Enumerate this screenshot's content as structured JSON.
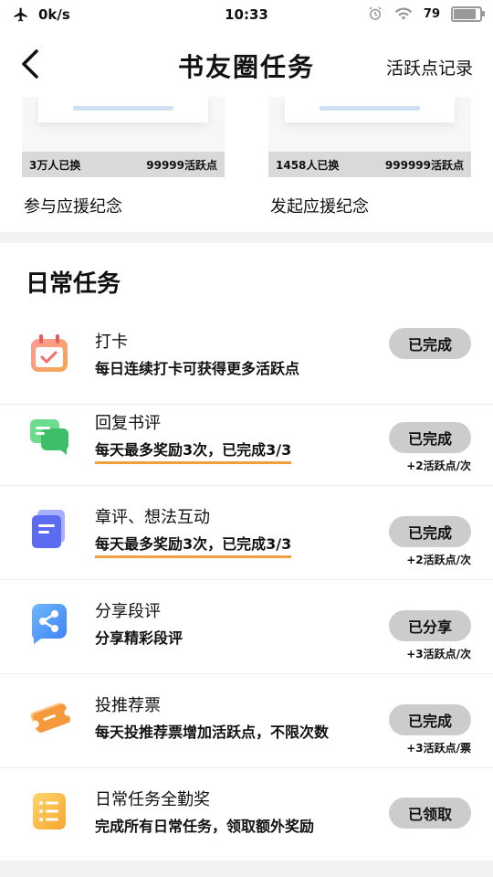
{
  "status_bar": {
    "speed": "0k/s",
    "time": "10:33",
    "battery": "79",
    "battery_level": 0.79
  },
  "header": {
    "title": "书友圈任务",
    "activity_record_link": "活跃点记录"
  },
  "support_cards": [
    {
      "count_text": "3万人已换",
      "points_text": "99999活跃点",
      "label": "参与应援纪念"
    },
    {
      "count_text": "1458人已换",
      "points_text": "999999活跃点",
      "label": "发起应援纪念"
    }
  ],
  "daily": {
    "section_title": "日常任务",
    "tasks": [
      {
        "icon": "calendar-check-icon",
        "name": "打卡",
        "desc": "每日连续打卡可获得更多活跃点",
        "button": "已完成",
        "reward": "",
        "accent": "#f36b6b"
      },
      {
        "icon": "chat-bubbles-icon",
        "name": "回复书评",
        "desc": "每天最多奖励3次，已完成3/3",
        "button": "已完成",
        "reward": "+2活跃点/次",
        "accent": "#3dbf6a"
      },
      {
        "icon": "document-icon",
        "name": "章评、想法互动",
        "desc": "每天最多奖励3次，已完成3/3",
        "button": "已完成",
        "reward": "+2活跃点/次",
        "accent": "#5b6cf0"
      },
      {
        "icon": "share-icon",
        "name": "分享段评",
        "desc": "分享精彩段评",
        "button": "已分享",
        "reward": "+3活跃点/次",
        "accent": "#3b8ff5"
      },
      {
        "icon": "ticket-icon",
        "name": "投推荐票",
        "desc": "每天投推荐票增加活跃点，不限次数",
        "button": "已完成",
        "reward": "+3活跃点/票",
        "accent": "#f59a3c"
      },
      {
        "icon": "list-icon",
        "name": "日常任务全勤奖",
        "desc": "完成所有日常任务，领取额外奖励",
        "button": "已领取",
        "reward": "",
        "accent": "#f7b531"
      }
    ]
  }
}
